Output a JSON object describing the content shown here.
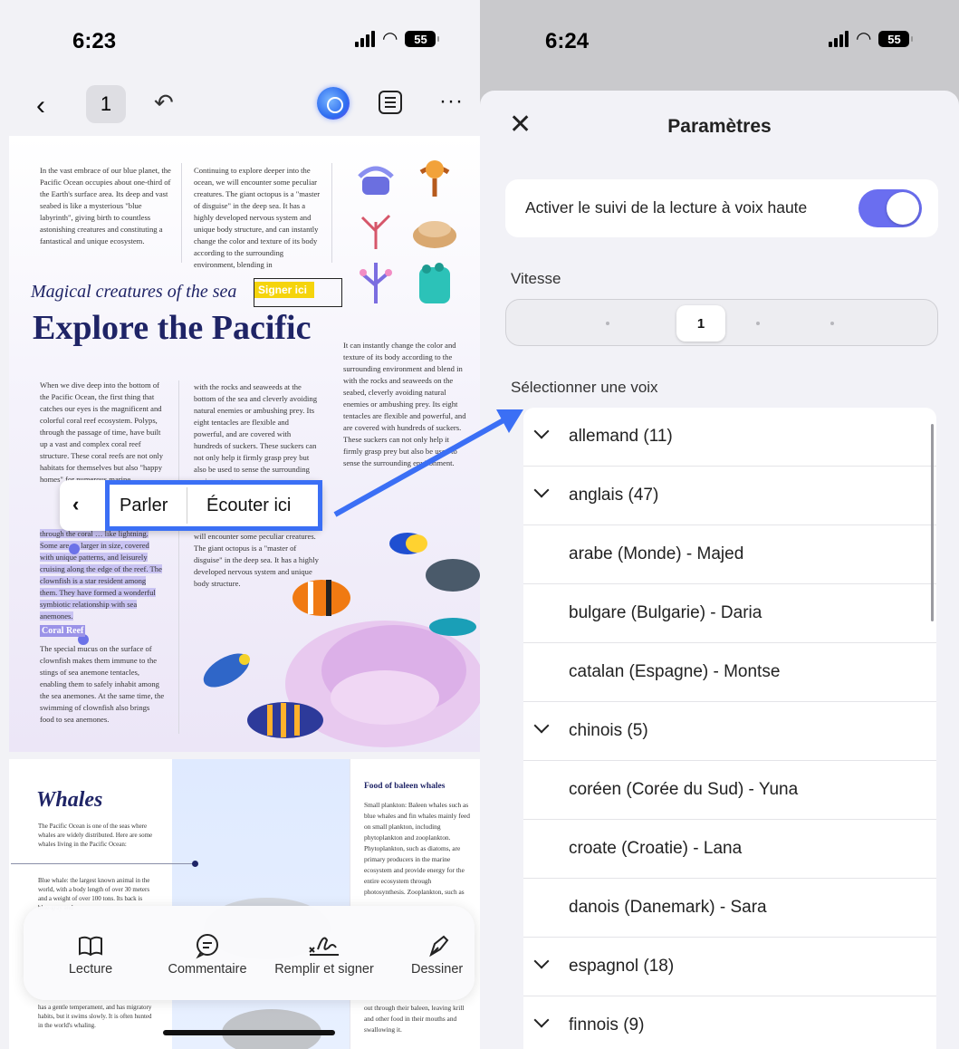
{
  "left": {
    "status": {
      "time": "6:23",
      "battery": "55"
    },
    "topbar": {
      "page": "1"
    },
    "doc": {
      "col1_top": "In the vast embrace of our blue planet, the Pacific Ocean occupies about one-third of the Earth's surface area. Its deep and vast seabed is like a mysterious \"blue labyrinth\", giving birth to countless astonishing creatures and constituting a fantastical and unique ecosystem.",
      "col2_top": "Continuing to explore deeper into the ocean, we will encounter some peculiar creatures. The giant octopus is a \"master of disguise\" in the deep sea. It has a highly developed nervous system and unique body structure, and can instantly change the color and texture of its body according to the surrounding environment, blending in",
      "subtitle": "Magical creatures of the sea",
      "title": "Explore the Pacific",
      "signer": "Signer ici",
      "col3_mid": "It can instantly change the color and texture of its body according to the surrounding environment and blend in with the rocks and seaweeds on the seabed, cleverly avoiding natural enemies or ambushing prey. Its eight tentacles are flexible and powerful, and are covered with hundreds of suckers. These suckers can not only help it firmly grasp prey but also be used to sense the surrounding environment.",
      "col1_mid": "When we dive deep into the bottom of the Pacific Ocean, the first thing that catches our eyes is the magnificent and colorful coral reef ecosystem. Polyps, through the passage of time, have built up a vast and complex coral reef structure. These coral reefs are not only habitats for themselves but also \"happy homes\" for numerous marine",
      "col1_low": "through the coral … like lightning. Some are … larger in size, covered with unique patterns, and leisurely cruising along the edge of the reef. The clownfish is a star resident among them. They have formed a wonderful symbiotic relationship with sea anemones.",
      "coral_heading": "Coral Reef",
      "col1_bottom": "The special mucus on the surface of clownfish makes them immune to the stings of sea anemone tentacles, enabling them to safely inhabit among the sea anemones. At the same time, the swimming of clownfish also brings food to sea anemones.",
      "col2_mid": "with the rocks and seaweeds at the bottom of the sea and cleverly avoiding natural enemies or ambushing prey. Its eight tentacles are flexible and powerful, and are covered with hundreds of suckers. These suckers can not only help it firmly grasp prey but also be used to sense the surrounding environment.",
      "col2_low": "will encounter some peculiar creatures. The giant octopus is a \"master of disguise\" in the deep sea. It has a highly developed nervous system and unique body structure.",
      "whales": "Whales",
      "whales_intro": "The Pacific Ocean is one of the seas where whales are widely distributed. Here are some whales living in the Pacific Ocean:",
      "blue_whale": "Blue whale: the largest known animal in the world, with a body length of over 30 meters and a weight of over 100 tons. Its back is blue-gray and",
      "whale_bottom": "has a gentle temperament, and has migratory habits, but it swims slowly. It is often hunted in the world's whaling.",
      "food_title": "Food of baleen whales",
      "food_text": "Small plankton: Baleen whales such as blue whales and fin whales mainly feed on small plankton, including phytoplankton and zooplankton. Phytoplankton, such as diatoms, are primary producers in the marine ecosystem and provide energy for the entire ecosystem through photosynthesis. Zooplankton, such as",
      "food_bottom": "out through their baleen, leaving krill and other food in their mouths and swallowing it."
    },
    "popup": {
      "speak": "Parler",
      "listen": "Écouter ici"
    },
    "toolbar": [
      {
        "label": "Lecture",
        "icon": "book-icon"
      },
      {
        "label": "Commentaire",
        "icon": "comment-icon"
      },
      {
        "label": "Remplir et signer",
        "icon": "signature-icon"
      },
      {
        "label": "Dessiner",
        "icon": "pen-icon"
      }
    ]
  },
  "right": {
    "status": {
      "time": "6:24",
      "battery": "55"
    },
    "sheet": {
      "title": "Paramètres",
      "toggle_label": "Activer le suivi de la lecture à voix haute",
      "toggle_on": true,
      "speed_label": "Vitesse",
      "speed_value": "1",
      "voice_label": "Sélectionner une voix",
      "voices": [
        {
          "label": "allemand (11)",
          "expandable": true
        },
        {
          "label": "anglais (47)",
          "expandable": true
        },
        {
          "label": "arabe (Monde) - Majed",
          "expandable": false
        },
        {
          "label": "bulgare (Bulgarie) - Daria",
          "expandable": false
        },
        {
          "label": "catalan (Espagne) - Montse",
          "expandable": false
        },
        {
          "label": "chinois (5)",
          "expandable": true
        },
        {
          "label": "coréen (Corée du Sud) - Yuna",
          "expandable": false
        },
        {
          "label": "croate (Croatie) - Lana",
          "expandable": false
        },
        {
          "label": "danois (Danemark) - Sara",
          "expandable": false
        },
        {
          "label": "espagnol (18)",
          "expandable": true
        },
        {
          "label": "finnois (9)",
          "expandable": true
        }
      ]
    }
  },
  "colors": {
    "accent": "#3b6ff5",
    "toggle": "#6a6ef0",
    "title": "#1f2466",
    "highlight": "#c9c3f2",
    "signer": "#f5d40c"
  }
}
